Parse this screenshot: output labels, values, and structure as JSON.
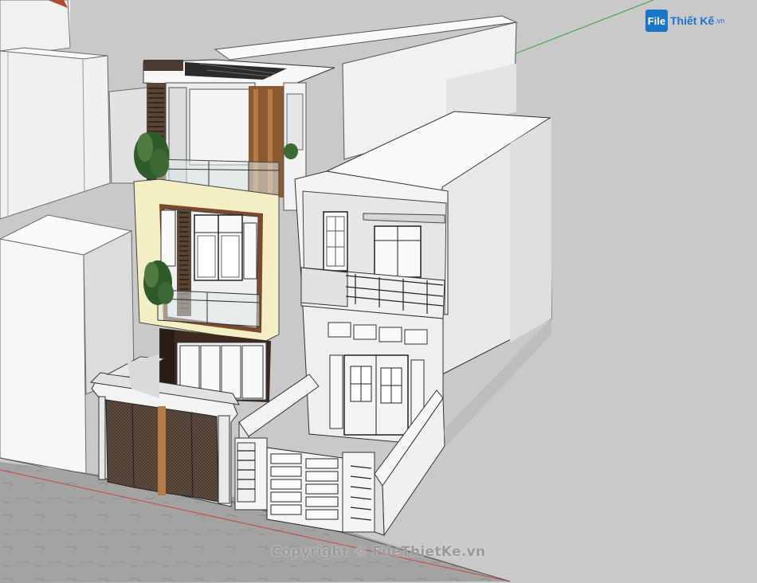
{
  "watermark": {
    "logo_mark": "File",
    "logo_text": "Thiết Kế",
    "logo_suffix": ".vn"
  },
  "copyright": "Copyright © FileThietKe.vn",
  "colors": {
    "sky": "#c9c9c9",
    "street": "#9e9e9e",
    "brand": "#1a75c9",
    "wood": "#7a4a2a",
    "cream": "#f3ecc4",
    "wall_white": "#f4f4f4",
    "wall_shadow": "#d8d8d8",
    "dark_stone": "#3c2a20"
  }
}
